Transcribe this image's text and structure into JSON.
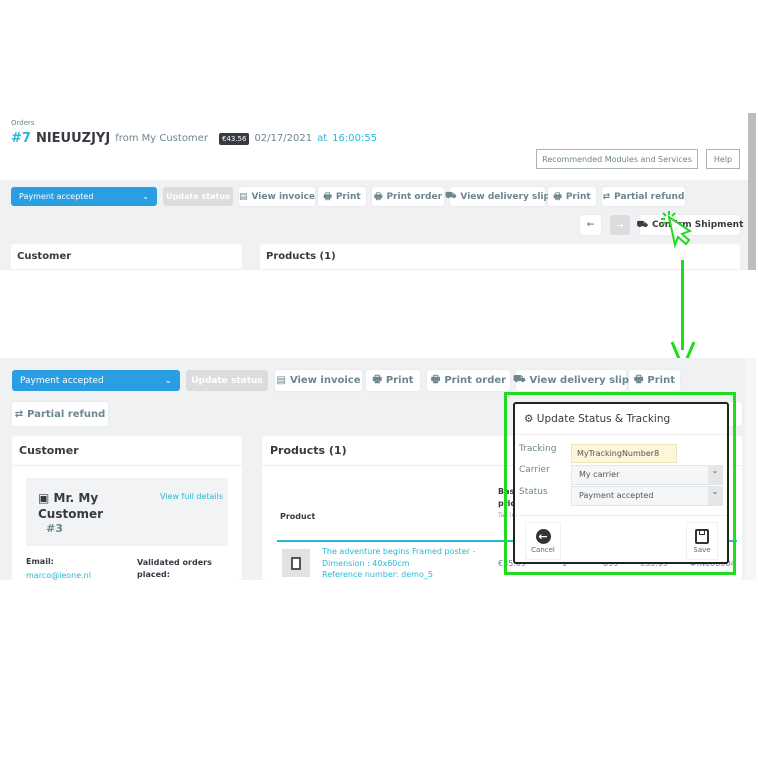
{
  "top": {
    "breadcrumb": "Orders",
    "order_number": "#7",
    "order_ref": "NIEUUZJYJ",
    "from_text": "from My Customer",
    "total_badge": "€43.56",
    "date": "02/17/2021",
    "at": "at",
    "time": "16:00:55",
    "recommended_button": "Recommended Modules and Services",
    "help_button": "Help",
    "status_select": "Payment accepted",
    "update_status": "Update status",
    "view_invoice": "View invoice",
    "print": "Print",
    "print_order": "Print order",
    "view_delivery_slip": "View delivery slip",
    "print2": "Print",
    "partial_refund": "Partial refund",
    "confirm_shipment": "Confirm Shipment",
    "customer_card": "Customer",
    "products_card": "Products (1)"
  },
  "bottom": {
    "status_select": "Payment accepted",
    "update_status": "Update status",
    "view_invoice": "View invoice",
    "print": "Print",
    "print_order": "Print order",
    "view_delivery_slip": "View delivery slip",
    "print2": "Print",
    "partial_refund": "Partial refund",
    "customer": {
      "title": "Customer",
      "name": "Mr. My Customer",
      "id": "#3",
      "view_details": "View full details",
      "email_label": "Email:",
      "email": "marco@leone.nl",
      "validated_label": "Validated orders placed:"
    },
    "products": {
      "title": "Products (1)",
      "col_product": "Product",
      "col_base_price": "Base price",
      "col_tax": "Tax incl.",
      "row": {
        "name": "The adventure begins Framed poster - Dimension : 40x60cm",
        "reference": "Reference number: demo_5",
        "base_price": "€35.09",
        "qty": "1",
        "stock": "899",
        "total": "€35.09",
        "invoice": "#IN000004"
      }
    }
  },
  "dialog": {
    "title": "Update Status & Tracking",
    "tracking_label": "Tracking",
    "tracking_value": "MyTrackingNumber8",
    "carrier_label": "Carrier",
    "carrier_value": "My carrier",
    "status_label": "Status",
    "status_value": "Payment accepted",
    "cancel": "Cancel",
    "save": "Save"
  },
  "colors": {
    "accent": "#2a9ee2",
    "link": "#25b9d7",
    "highlight": "#1fdc1f",
    "tracking_bg": "#fdf6d8"
  }
}
